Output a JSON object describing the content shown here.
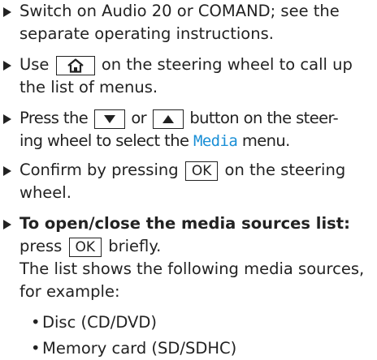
{
  "items": [
    {
      "text": "Switch on Audio 20 or COMAND; see the separate operating instructions."
    },
    {
      "pre": "Use",
      "key_icon": "home-icon",
      "post": "on the steering wheel to call up the list of menus."
    },
    {
      "pre": "Press the",
      "key1_icon": "down-triangle-icon",
      "mid": "or",
      "key2_icon": "up-triangle-icon",
      "post_line1": "button on the steer-",
      "post_line2a": "ing wheel to select the",
      "highlight": "Media",
      "post_line2b": "menu."
    },
    {
      "pre": "Confirm by pressing",
      "key": "OK",
      "post": "on the steering wheel."
    },
    {
      "bold": "To open/close the media sources list:",
      "pre": "press",
      "key": "OK",
      "post": "briefly.",
      "desc": "The list shows the following media sources, for example:"
    }
  ],
  "sources": [
    "Disc (CD/DVD)",
    "Memory card (SD/SDHC)"
  ]
}
